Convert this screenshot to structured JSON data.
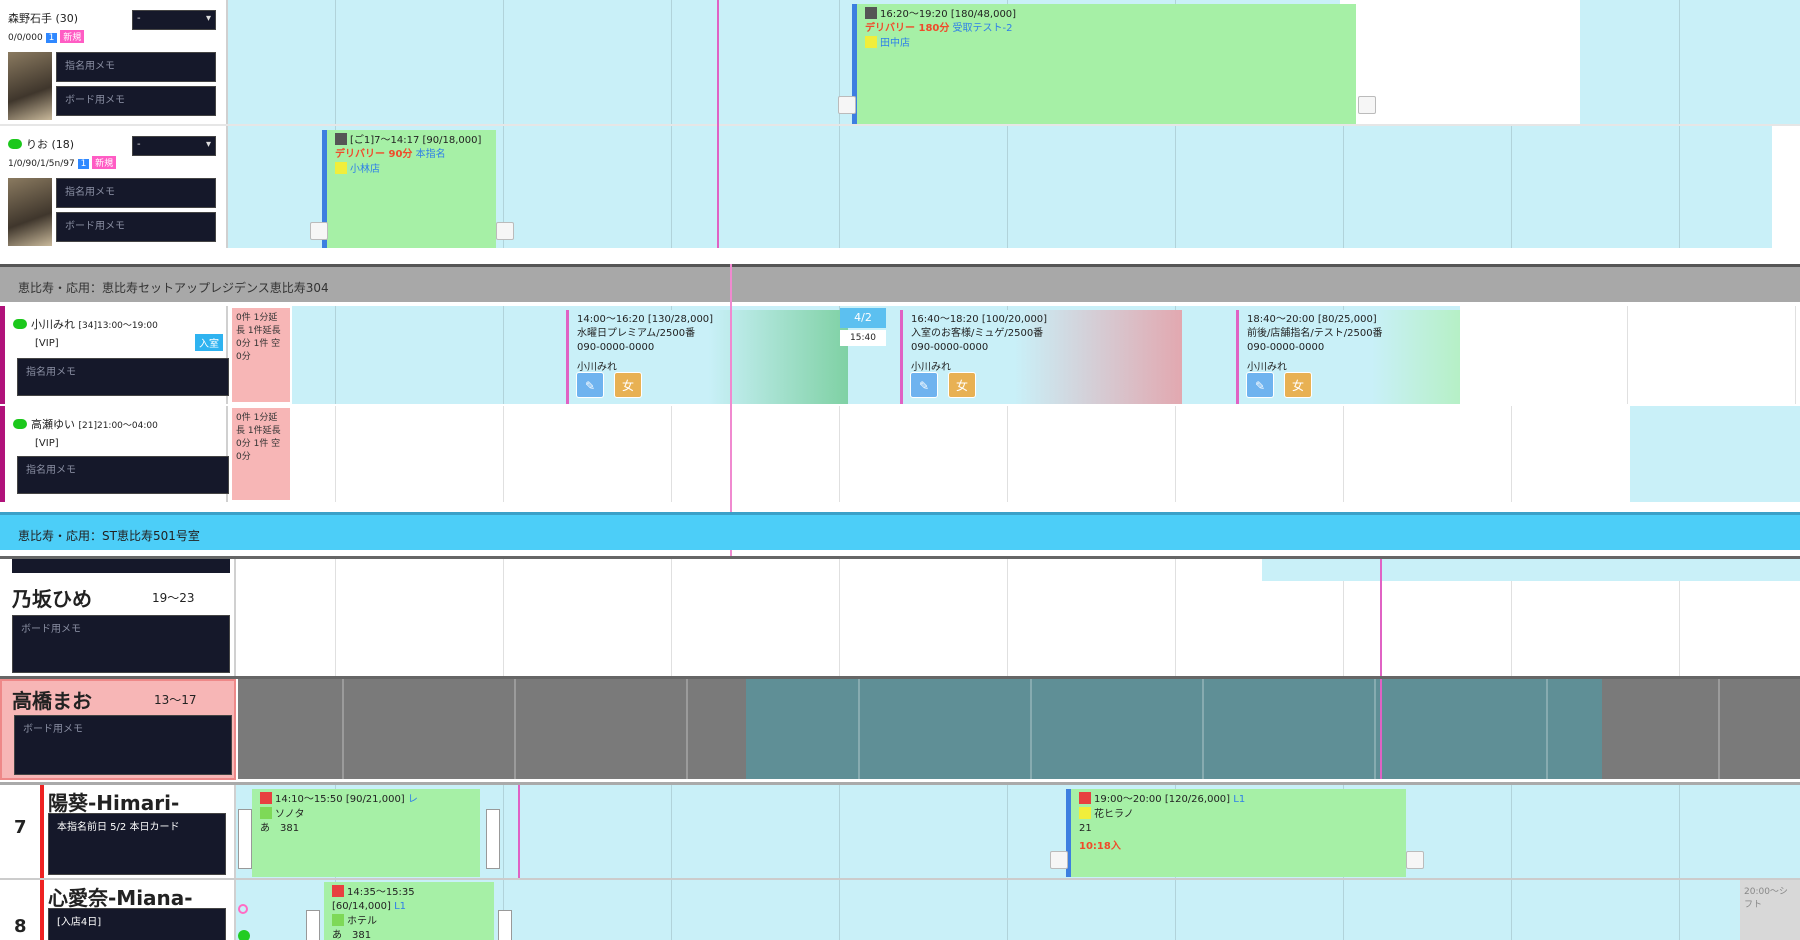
{
  "top_rows": [
    {
      "name": "森野石手 (30)",
      "sub": "0/0/000",
      "badge_blue": "1",
      "badge_pink": "新規",
      "select_value": "-",
      "memo1": "指名用メモ",
      "memo2": "ボード用メモ"
    },
    {
      "name": "りお (18)",
      "sub": "1/0/90/1/5n/97",
      "badge_blue": "1",
      "badge_pink": "新規",
      "select_value": "-",
      "memo1": "指名用メモ",
      "memo2": "ボード用メモ"
    }
  ],
  "top_bookings": [
    {
      "time": "16:20〜19:20 [180/48,000]",
      "course": "デリバリー 180分",
      "extra": "受取テスト-2",
      "staff": "田中店"
    },
    {
      "time": "[ご1]7〜14:17 [90/18,000]",
      "course": "デリバリー 90分",
      "extra": "本指名",
      "staff": "小林店"
    }
  ],
  "section1": {
    "title": "恵比寿・応用：恵比寿セットアップレジデンス恵比寿304"
  },
  "section1_rows": [
    {
      "name": "小川みれ",
      "time": "[34]13:00〜19:00",
      "tag": "[VIP]",
      "status": "入室",
      "memo": "指名用メモ",
      "side_note": "0件 1分延長 1件延長 0分 1件 空 0分"
    },
    {
      "name": "高瀬ゆい",
      "time": "[21]21:00〜04:00",
      "tag": "[VIP]",
      "memo": "指名用メモ",
      "side_note": "0件 1分延長 1件延長 0分 1件 空 0分"
    }
  ],
  "section1_bookings": [
    {
      "time": "14:00〜16:20 [130/28,000]",
      "line2": "水曜日プレミアム/2500番",
      "line3": "090-0000-0000",
      "staff": "小川みれ",
      "btn1": "✎",
      "btn2": "女"
    },
    {
      "time": "16:40〜18:20 [100/20,000]",
      "line2": "入室のお客様/ミュゲ/2500番",
      "line3": "090-0000-0000",
      "staff": "小川みれ",
      "btn1": "✎",
      "btn2": "女"
    },
    {
      "time": "18:40〜20:00 [80/25,000]",
      "line2": "前後/店舗指名/テスト/2500番",
      "line3": "090-0000-0000",
      "staff": "小川みれ",
      "btn1": "✎",
      "btn2": "女"
    }
  ],
  "section1_float": {
    "label": "4/2",
    "sub": "15:40"
  },
  "section2": {
    "title": "恵比寿・応用：ST恵比寿501号室"
  },
  "big_rows": [
    {
      "name": "乃坂ひめ",
      "hours": "19〜23",
      "memo": "ボード用メモ"
    },
    {
      "name": "高橋まお",
      "hours": "13〜17",
      "memo": "ボード用メモ"
    }
  ],
  "numbered_rows": [
    {
      "no": "7",
      "name": "陽葵-Himari-",
      "memo": "本指名前日 5/2 本日カード",
      "booking1": {
        "time": "14:10〜15:50 [90/21,000]",
        "note": "レ",
        "line": "ソノタ",
        "line2": "あ　381"
      },
      "booking2": {
        "time": "19:00〜20:00 [120/26,000]",
        "note": "L1",
        "line": "花ヒラノ",
        "line2": "21",
        "alert": "10:18入"
      }
    },
    {
      "no": "8",
      "name": "心愛奈-Miana-",
      "memo": "[入店4日]",
      "booking1": {
        "time": "14:35〜15:35",
        "note": "L1",
        "line": "[60/14,000]",
        "line2": "ホテル",
        "line3": "あ　381"
      },
      "end_note": "20:00〜シフト"
    }
  ],
  "colors": {
    "lane_blue": "#c9f0f8",
    "booking_green": "#a6f0a6",
    "section1_bar": "#a8a8a8",
    "section2_bar": "#4ccef8",
    "memo_dark": "#15182a",
    "accent_pink": "#e062c4"
  }
}
